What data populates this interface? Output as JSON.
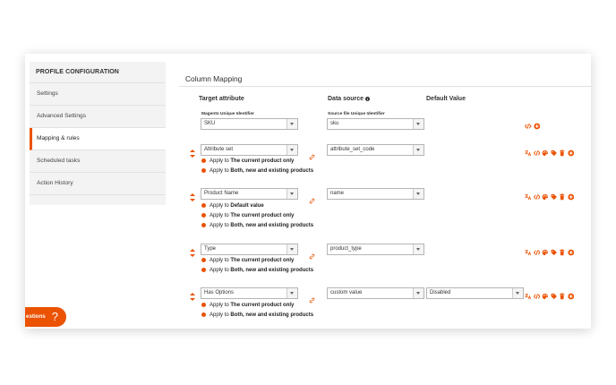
{
  "sidebar": {
    "header": "PROFILE CONFIGURATION",
    "items": [
      {
        "label": "Settings"
      },
      {
        "label": "Advanced Settings"
      },
      {
        "label": "Mapping & rules"
      },
      {
        "label": "Scheduled tasks"
      },
      {
        "label": "Action History"
      }
    ]
  },
  "main": {
    "title": "Column Mapping",
    "headers": {
      "target": "Target attribute",
      "source": "Data source",
      "default": "Default Value"
    },
    "identifier": {
      "target_label": "Magento Unique Identifier",
      "target_value": "SKU",
      "source_label": "Source file Unique Identifier",
      "source_value": "sku"
    },
    "rows": [
      {
        "target": "Attribute set",
        "source": "attribute_set_code",
        "options": [
          {
            "prefix": "Apply to ",
            "bold": "The current product only"
          },
          {
            "prefix": "Apply to ",
            "bold": "Both, new and existing products"
          }
        ]
      },
      {
        "target": "Product Name",
        "source": "name",
        "options": [
          {
            "prefix": "Apply to ",
            "bold": "Default value"
          },
          {
            "prefix": "Apply to ",
            "bold": "The current product only"
          },
          {
            "prefix": "Apply to ",
            "bold": "Both, new and existing products"
          }
        ]
      },
      {
        "target": "Type",
        "source": "product_type",
        "options": [
          {
            "prefix": "Apply to ",
            "bold": "The current product only"
          },
          {
            "prefix": "Apply to ",
            "bold": "Both, new and existing products"
          }
        ]
      },
      {
        "target": "Has Options",
        "source": "custom value",
        "default": "Disabled",
        "options": [
          {
            "prefix": "Apply to ",
            "bold": "The current product only"
          },
          {
            "prefix": "Apply to ",
            "bold": "Both, new and existing products"
          }
        ]
      }
    ]
  },
  "help": {
    "label": "estions",
    "icon": "?"
  },
  "colors": {
    "accent": "#eb5202",
    "sidebar_bg": "#f3f3f3"
  }
}
